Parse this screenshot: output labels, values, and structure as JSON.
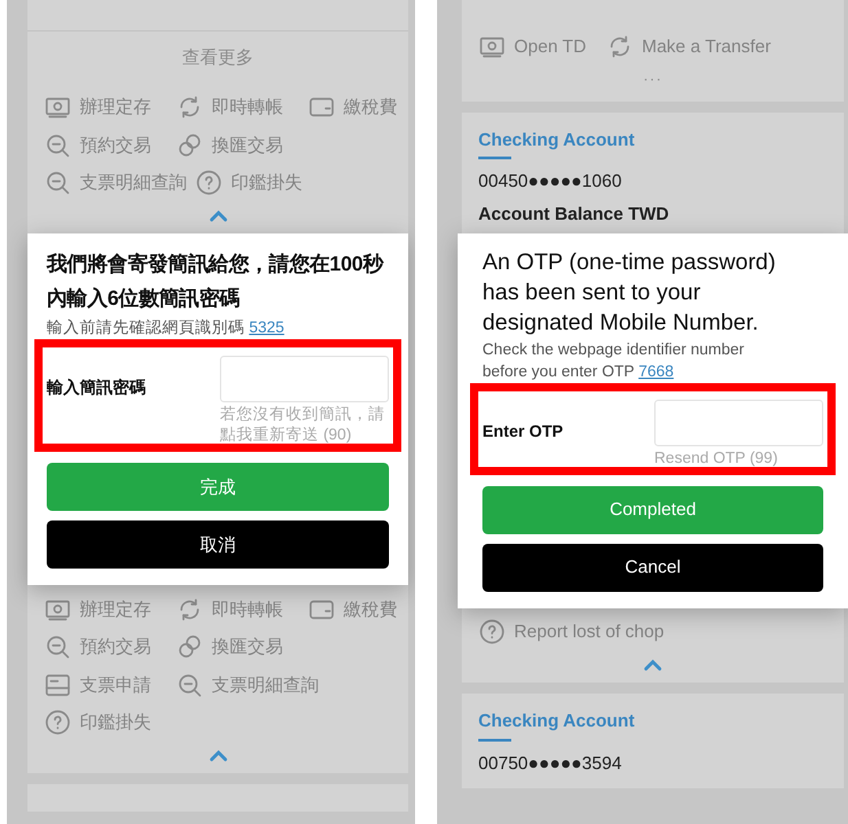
{
  "screens": [
    {
      "above": [
        {
          "kind": "more_link",
          "label": "查看更多"
        },
        {
          "kind": "actions",
          "rows": [
            {
              "items": [
                {
                  "kind": "deposit",
                  "label": "辦理定存"
                },
                {
                  "kind": "transfer",
                  "label": "即時轉帳"
                },
                {
                  "kind": "wallet",
                  "label": "繳稅費"
                }
              ]
            },
            {
              "items": [
                {
                  "kind": "search",
                  "label": "預約交易"
                },
                {
                  "kind": "exchange",
                  "label": "換匯交易"
                }
              ]
            },
            {
              "items": [
                {
                  "kind": "search",
                  "label": "支票明細查詢"
                },
                {
                  "kind": "help",
                  "label": "印鑑掛失"
                }
              ]
            }
          ]
        },
        {
          "kind": "collapse"
        }
      ],
      "dialog": {
        "title": "我們將會寄發簡訊給您，請您在100秒內輸入6位數簡訊密碼",
        "note": "輸入前請先確認網頁識別碼",
        "code": "5325",
        "field_label": "輸入簡訊密碼",
        "hint": "若您沒有收到簡訊，請點我重新寄送 (90)",
        "highlighted": true,
        "buttons": [
          {
            "kind": "primary",
            "label": "完成"
          },
          {
            "kind": "cancel",
            "label": "取消"
          }
        ]
      },
      "below": [
        {
          "kind": "actions",
          "rows": [
            {
              "items": [
                {
                  "kind": "deposit",
                  "label": "辦理定存"
                },
                {
                  "kind": "transfer",
                  "label": "即時轉帳"
                },
                {
                  "kind": "wallet",
                  "label": "繳稅費"
                }
              ]
            },
            {
              "items": [
                {
                  "kind": "search",
                  "label": "預約交易"
                },
                {
                  "kind": "exchange",
                  "label": "換匯交易"
                }
              ]
            },
            {
              "items": [
                {
                  "kind": "cheque",
                  "label": "支票申請"
                },
                {
                  "kind": "search",
                  "label": "支票明細查詢"
                }
              ]
            },
            {
              "items": [
                {
                  "kind": "help",
                  "label": "印鑑掛失"
                }
              ]
            }
          ]
        },
        {
          "kind": "collapse"
        },
        {
          "kind": "card_edge"
        }
      ]
    },
    {
      "above": [
        {
          "kind": "actions",
          "rows": [
            {
              "items": [
                {
                  "kind": "deposit",
                  "label": "Open TD"
                },
                {
                  "kind": "transfer",
                  "label": "Make a Transfer"
                }
              ]
            }
          ],
          "more": "···"
        },
        {
          "kind": "account",
          "title": "Checking Account",
          "number": "00450●●●●●1060",
          "balance_label": "Account Balance TWD"
        }
      ],
      "dialog": {
        "title": "An OTP (one-time password) has been sent to your designated Mobile Number.",
        "note": "Check the webpage identifier number before you enter OTP",
        "code": "7668",
        "field_label": "Enter OTP",
        "hint": "Resend OTP (99)",
        "highlighted": true,
        "buttons": [
          {
            "kind": "primary",
            "label": "Completed"
          },
          {
            "kind": "cancel",
            "label": "Cancel"
          }
        ]
      },
      "below": [
        {
          "kind": "actions",
          "rows": [
            {
              "items": [
                {
                  "kind": "help",
                  "label": "Report lost of chop"
                }
              ]
            }
          ]
        },
        {
          "kind": "collapse"
        },
        {
          "kind": "account",
          "title": "Checking Account",
          "number": "00750●●●●●3594"
        }
      ]
    }
  ]
}
